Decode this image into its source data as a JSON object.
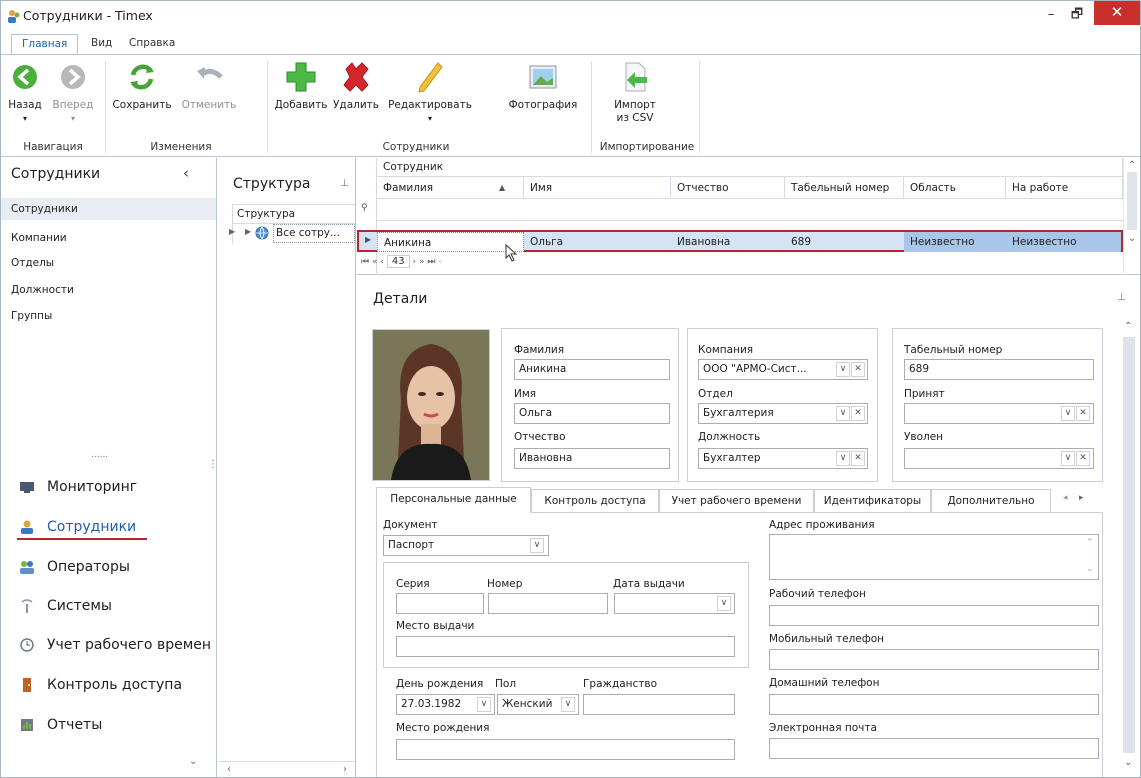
{
  "window": {
    "title": "Сотрудники - Timex"
  },
  "ribbon_tabs": [
    "Главная",
    "Вид",
    "Справка"
  ],
  "ribbon": {
    "buttons": {
      "back": "Назад",
      "forward": "Вперед",
      "save": "Сохранить",
      "cancel": "Отменить",
      "add": "Добавить",
      "delete": "Удалить",
      "edit": "Редактировать",
      "photo": "Фотография",
      "import_l1": "Импорт",
      "import_l2": "из CSV"
    },
    "groups": {
      "nav": "Навигация",
      "changes": "Изменения",
      "employees": "Сотрудники",
      "import": "Импортирование"
    }
  },
  "left_nav": {
    "header": "Сотрудники",
    "items": [
      "Сотрудники",
      "Компании",
      "Отделы",
      "Должности",
      "Группы"
    ],
    "splitter": "......",
    "big_items": [
      "Мониторинг",
      "Сотрудники",
      "Операторы",
      "Системы",
      "Учет рабочего времен",
      "Контроль доступа",
      "Отчеты"
    ]
  },
  "structure": {
    "title": "Структура",
    "column": "Структура",
    "node": "Все сотру..."
  },
  "grid": {
    "band": "Сотрудник",
    "columns": [
      "Фамилия",
      "Имя",
      "Отчество",
      "Табельный номер",
      "Область",
      "На работе"
    ],
    "row": [
      "Аникина",
      "Ольга",
      "Ивановна",
      "689",
      "Неизвестно",
      "Неизвестно"
    ],
    "page": "43"
  },
  "details": {
    "title": "Детали",
    "labels": {
      "last": "Фамилия",
      "first": "Имя",
      "middle": "Отчество",
      "company": "Компания",
      "dept": "Отдел",
      "position": "Должность",
      "tab_no": "Табельный номер",
      "hired": "Принят",
      "fired": "Уволен"
    },
    "values": {
      "last": "Аникина",
      "first": "Ольга",
      "middle": "Ивановна",
      "company": "ООО \"АРМО-Сист...",
      "dept": "Бухгалтерия",
      "position": "Бухгалтер",
      "tab_no": "689",
      "hired": "",
      "fired": ""
    },
    "tabs": [
      "Персональные данные",
      "Контроль доступа",
      "Учет рабочего времени",
      "Идентификаторы",
      "Дополнительно"
    ],
    "personal": {
      "document_label": "Документ",
      "document": "Паспорт",
      "series": "Серия",
      "number": "Номер",
      "issue_date": "Дата выдачи",
      "issue_place": "Место выдачи",
      "birthday_label": "День рождения",
      "birthday": "27.03.1982",
      "gender_label": "Пол",
      "gender": "Женский",
      "citizenship": "Гражданство",
      "birthplace": "Место рождения",
      "address": "Адрес проживания",
      "work_phone": "Рабочий телефон",
      "mobile_phone": "Мобильный телефон",
      "home_phone": "Домашний телефон",
      "email": "Электронная почта"
    }
  },
  "colors": {
    "accent": "#1e5fb5",
    "selection_border": "#b3272d",
    "add_green": "#4cb848",
    "delete_red": "#d4262b"
  }
}
